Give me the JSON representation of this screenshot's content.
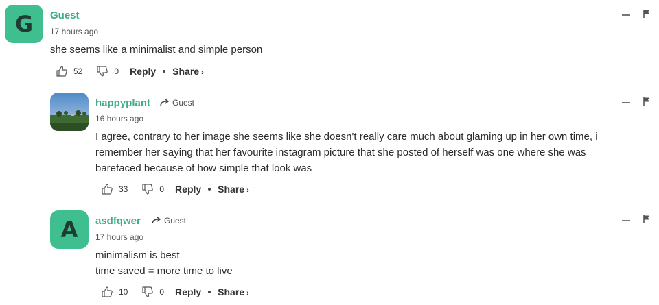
{
  "comments": [
    {
      "avatar_letter": "G",
      "username": "Guest",
      "reply_to": "",
      "timestamp": "17 hours ago",
      "body_lines": [
        "she seems like a minimalist and simple person"
      ],
      "likes": "52",
      "dislikes": "0",
      "reply_label": "Reply",
      "share_label": "Share",
      "share_chevron": "›"
    },
    {
      "avatar_image": "landscape photo avatar",
      "username": "happyplant",
      "reply_to": "Guest",
      "timestamp": "16 hours ago",
      "body_lines": [
        "I agree, contrary to her image she seems like she doesn't really care much about glaming up in her own time, i",
        "remember her saying that her favourite instagram picture that she posted of herself was one where she was",
        "barefaced because of how simple that look was"
      ],
      "likes": "33",
      "dislikes": "0",
      "reply_label": "Reply",
      "share_label": "Share",
      "share_chevron": "›"
    },
    {
      "avatar_letter": "A",
      "username": "asdfqwer",
      "reply_to": "Guest",
      "timestamp": "17 hours ago",
      "body_lines": [
        "minimalism is best",
        "time saved = more time to live"
      ],
      "likes": "10",
      "dislikes": "0",
      "reply_label": "Reply",
      "share_label": "Share",
      "share_chevron": "›"
    }
  ],
  "colors": {
    "accent": "#3cae84",
    "avatar_bg": "#3fbf8f",
    "text": "#2b2b2b"
  },
  "icons": [
    "thumb-up-icon",
    "thumb-down-icon",
    "reply-arrow-icon",
    "collapse-icon",
    "flag-icon"
  ]
}
